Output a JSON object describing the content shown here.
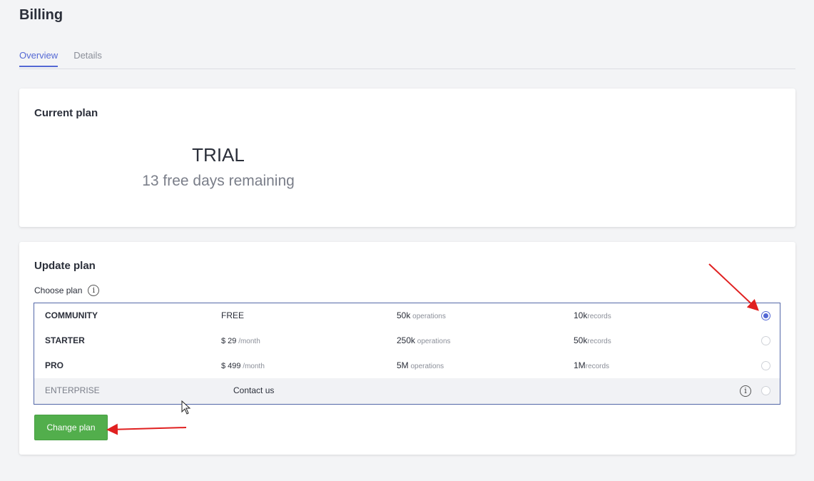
{
  "header": {
    "title": "Billing"
  },
  "tabs": [
    {
      "label": "Overview",
      "active": true
    },
    {
      "label": "Details",
      "active": false
    }
  ],
  "current_plan": {
    "title": "Current plan",
    "plan_name": "TRIAL",
    "remaining": "13 free days remaining"
  },
  "update_plan": {
    "title": "Update plan",
    "choose_label": "Choose plan",
    "plans": [
      {
        "name": "COMMUNITY",
        "price": "FREE",
        "price_suffix": "",
        "ops_value": "50k",
        "ops_unit": " operations",
        "records_value": "10k",
        "records_unit": "records",
        "selected": true
      },
      {
        "name": "STARTER",
        "price": "$ 29",
        "price_suffix": " /month",
        "ops_value": "250k",
        "ops_unit": " operations",
        "records_value": "50k",
        "records_unit": "records",
        "selected": false
      },
      {
        "name": "PRO",
        "price": "$ 499",
        "price_suffix": " /month",
        "ops_value": "5M",
        "ops_unit": " operations",
        "records_value": "1M",
        "records_unit": "records",
        "selected": false
      }
    ],
    "enterprise": {
      "name": "ENTERPRISE",
      "contact": "Contact us",
      "selected": false
    },
    "change_button": "Change plan"
  },
  "colors": {
    "accent": "#5468d4",
    "button": "#52ae4c",
    "annotation_arrow": "#e02020"
  }
}
